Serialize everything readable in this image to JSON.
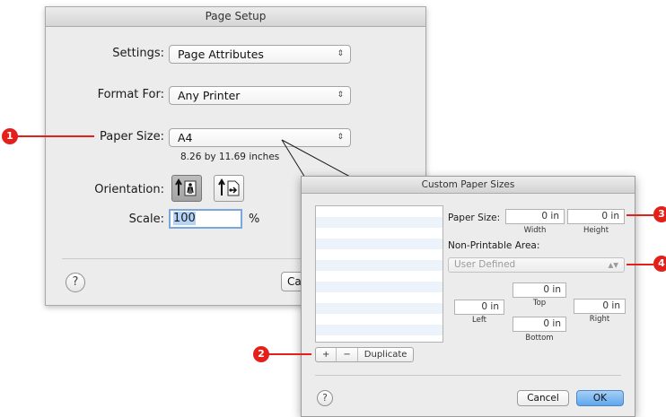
{
  "page_setup": {
    "title": "Page Setup",
    "settings_label": "Settings:",
    "settings_value": "Page Attributes",
    "format_label": "Format For:",
    "format_value": "Any Printer",
    "paper_label": "Paper Size:",
    "paper_value": "A4",
    "paper_dims": "8.26 by 11.69 inches",
    "orientation_label": "Orientation:",
    "scale_label": "Scale:",
    "scale_value": "100",
    "scale_unit": "%",
    "help": "?",
    "cancel_partial": "Ca"
  },
  "custom_paper": {
    "title": "Custom Paper Sizes",
    "list_buttons": {
      "add": "+",
      "remove": "−",
      "duplicate": "Duplicate"
    },
    "paper_size_label": "Paper Size:",
    "width_value": "0 in",
    "width_label": "Width",
    "height_value": "0 in",
    "height_label": "Height",
    "non_printable_label": "Non-Printable Area:",
    "non_printable_value": "User Defined",
    "margins": {
      "top_value": "0 in",
      "top_label": "Top",
      "left_value": "0 in",
      "left_label": "Left",
      "right_value": "0 in",
      "right_label": "Right",
      "bottom_value": "0 in",
      "bottom_label": "Bottom"
    },
    "help": "?",
    "cancel": "Cancel",
    "ok": "OK"
  },
  "callouts": [
    "1",
    "2",
    "3",
    "4"
  ],
  "colors": {
    "callout": "#e4201a",
    "default_button": "#5da7ec"
  }
}
